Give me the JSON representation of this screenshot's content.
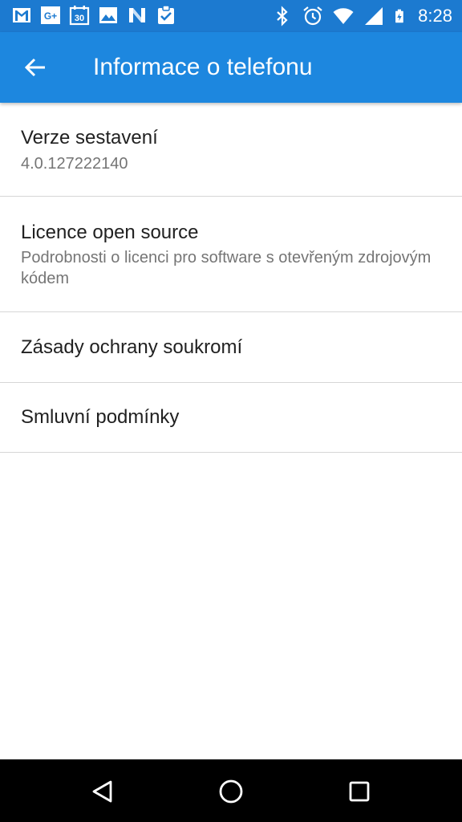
{
  "status_bar": {
    "time": "8:28",
    "notification_icons": [
      "gmail-icon",
      "google-plus-icon",
      "calendar-icon",
      "photos-icon",
      "n-app-icon",
      "clipboard-check-icon"
    ],
    "calendar_day": "30",
    "google_plus_text": "G+",
    "system_icons": [
      "bluetooth-icon",
      "alarm-icon",
      "wifi-icon",
      "signal-icon",
      "battery-charging-icon"
    ]
  },
  "app_bar": {
    "title": "Informace o telefonu",
    "back_icon": "arrow-back-icon"
  },
  "items": [
    {
      "title": "Verze sestavení",
      "summary": "4.0.127222140"
    },
    {
      "title": "Licence open source",
      "summary": "Podrobnosti o licenci pro software s otevřeným zdrojovým kódem"
    },
    {
      "title": "Zásady ochrany soukromí"
    },
    {
      "title": "Smluvní podmínky"
    }
  ],
  "nav_bar": {
    "buttons": [
      "back-triangle-icon",
      "home-circle-icon",
      "recents-square-icon"
    ]
  },
  "colors": {
    "status_bar": "#1c7ad0",
    "app_bar": "#1d87df",
    "title_text": "#212121",
    "summary_text": "#757575",
    "divider": "#d6d6d6",
    "nav_bar": "#000000"
  }
}
